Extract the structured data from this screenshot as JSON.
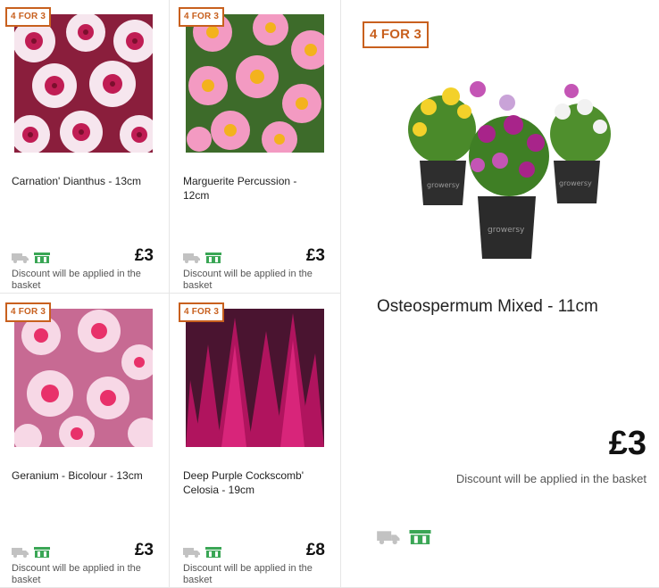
{
  "products": [
    {
      "badge": "4 FOR 3",
      "title": "Carnation' Dianthus - 13cm",
      "price": "£3",
      "discount": "Discount will be applied in the basket"
    },
    {
      "badge": "4 FOR 3",
      "title": "Marguerite Percussion - 12cm",
      "price": "£3",
      "discount": "Discount will be applied in the basket"
    },
    {
      "badge": "4 FOR 3",
      "title": "Geranium - Bicolour - 13cm",
      "price": "£3",
      "discount": "Discount will be applied in the basket"
    },
    {
      "badge": "4 FOR 3",
      "title": "Deep Purple Cockscomb' Celosia - 19cm",
      "price": "£8",
      "discount": "Discount will be applied in the basket"
    }
  ],
  "featured": {
    "badge": "4 FOR 3",
    "title": "Osteospermum Mixed - 11cm",
    "price": "£3",
    "discount": "Discount will be applied in the basket",
    "pot_brand": "growersy"
  },
  "colors": {
    "badge": "#c8601e",
    "delivery_icon": "#c2c2c2",
    "collect_icon": "#3aa655"
  },
  "icons": {
    "delivery": "delivery-truck-icon",
    "collect": "click-collect-basket-icon"
  }
}
